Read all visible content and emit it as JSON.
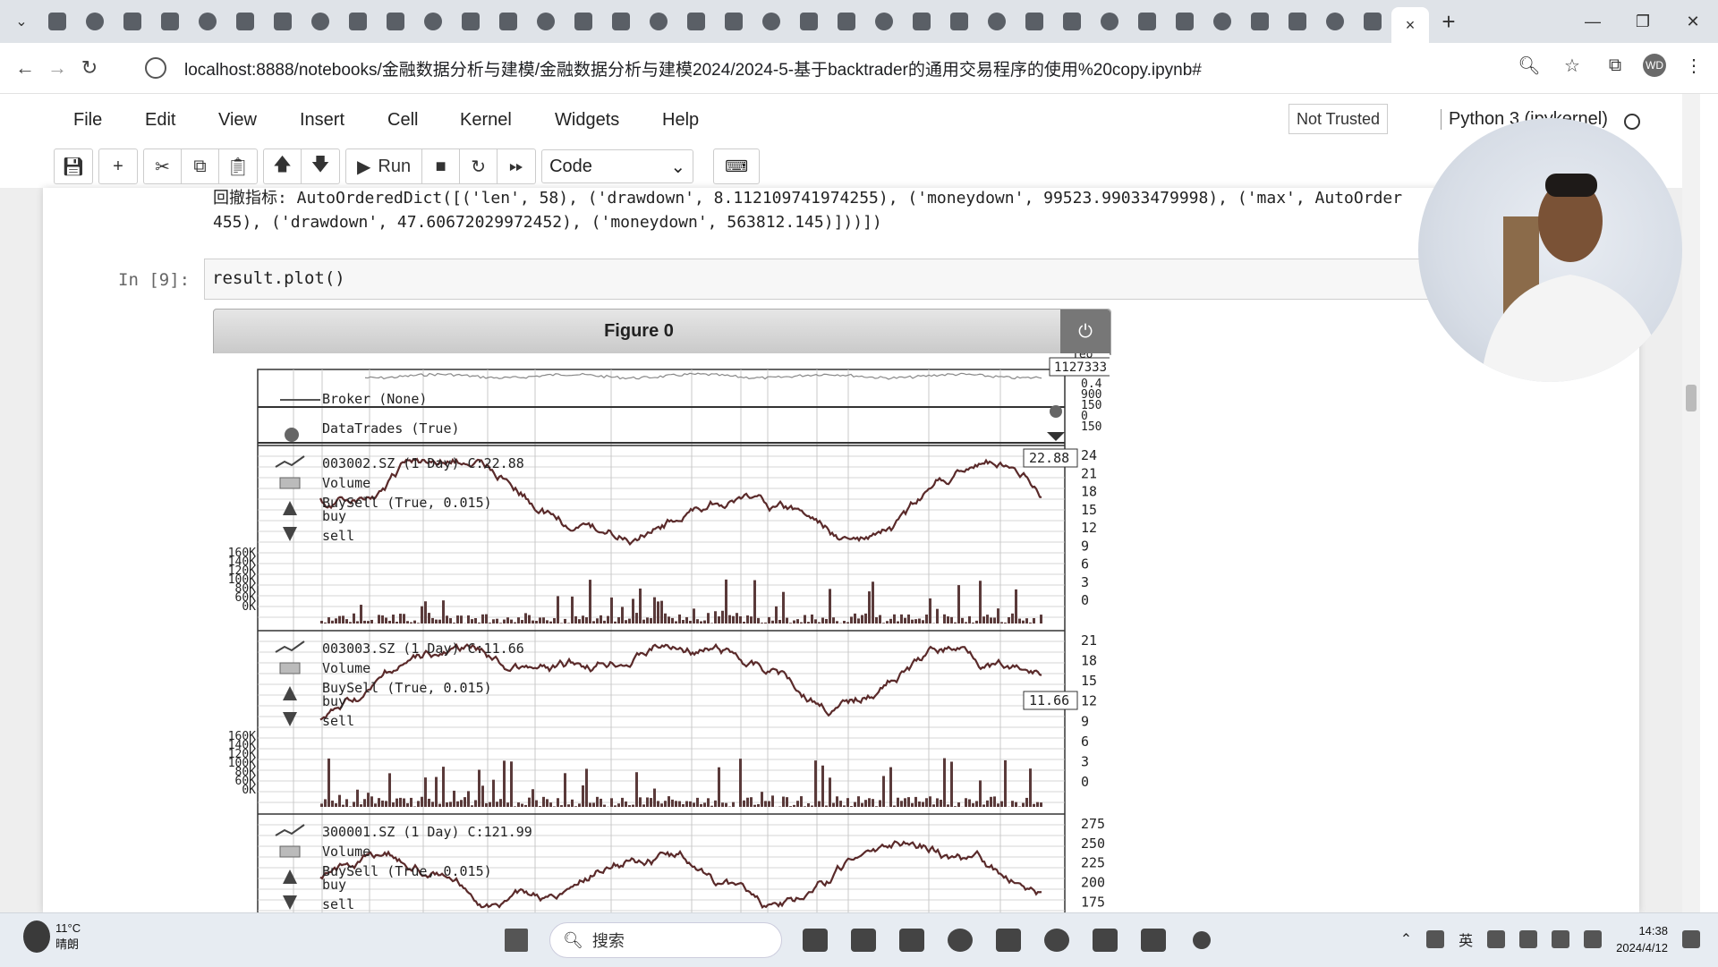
{
  "browser": {
    "tab_strip": {
      "active_close": "×",
      "new_tab": "+",
      "tab_icons": [
        "bilibili",
        "chat",
        "circle",
        "github",
        "notion",
        "media",
        "media2",
        "fiftyone",
        "github",
        "message",
        "cloud",
        "cloud2",
        "figure",
        "book",
        "avatar",
        "globe",
        "kit",
        "flower",
        "github",
        "github",
        "disc",
        "zhihu",
        "zhihu",
        "github",
        "c-app",
        "aiyou",
        "globe",
        "m-app",
        "k-app",
        "simplified",
        "loop",
        "book",
        "book",
        "book",
        "paw",
        "zhihu"
      ],
      "window_controls": {
        "minimize": "—",
        "restore": "❐",
        "close": "✕"
      }
    },
    "url": "localhost:8888/notebooks/金融数据分析与建模/金融数据分析与建模2024/2024-5-基于backtrader的通用交易程序的使用%20copy.ipynb#",
    "profile_badge": "WD"
  },
  "jupyter": {
    "menu": [
      "File",
      "Edit",
      "View",
      "Insert",
      "Cell",
      "Kernel",
      "Widgets",
      "Help"
    ],
    "trust_status": "Not Trusted",
    "kernel_name": "Python 3 (ipykernel)",
    "toolbar": {
      "run_label": "Run",
      "cell_type": "Code"
    }
  },
  "notebook": {
    "output_line1": "回撤指标: AutoOrderedDict([('len', 58), ('drawdown', 8.112109741974255), ('moneydown', 99523.99033479998), ('max', AutoOrder",
    "output_line2": "455), ('drawdown', 47.60672029972452), ('moneydown', 563812.145)]))])",
    "prompt": "In  [9]:",
    "code": "result.plot()"
  },
  "figure": {
    "title": "Figure 0",
    "broker_panel": {
      "legend": "Broker (None)",
      "value_label": "1127333.0",
      "axis_ticks": [
        "0.4",
        "900",
        "150",
        "0",
        "150"
      ],
      "top_fragment": "Teo"
    },
    "trades_panel": {
      "legend": "DataTrades (True)"
    },
    "stocks": [
      {
        "legend": "003002.SZ (1 Day) C:22.88",
        "last_label": "22.88",
        "price_ticks": [
          "24",
          "21",
          "18",
          "15",
          "12",
          "9",
          "6",
          "3",
          "0"
        ],
        "sub_legends": [
          "Volume",
          "BuySell (True, 0.015)",
          "buy",
          "sell"
        ],
        "volume_ticks": [
          "160K",
          "140K",
          "120K",
          "100K",
          "80K",
          "60K",
          "0K"
        ]
      },
      {
        "legend": "003003.SZ (1 Day) C:11.66",
        "last_label": "11.66",
        "price_ticks": [
          "21",
          "18",
          "15",
          "12",
          "9",
          "6",
          "3",
          "0"
        ],
        "sub_legends": [
          "Volume",
          "BuySell (True, 0.015)",
          "buy",
          "sell"
        ],
        "volume_ticks": [
          "160K",
          "140K",
          "120K",
          "100K",
          "80K",
          "60K",
          "0K"
        ]
      },
      {
        "legend": "300001.SZ (1 Day) C:121.99",
        "last_label": "",
        "price_ticks": [
          "275",
          "250",
          "225",
          "200",
          "175"
        ],
        "sub_legends": [
          "Volume",
          "BuySell (True, 0.015)",
          "buy",
          "sell"
        ],
        "volume_ticks": []
      }
    ]
  },
  "taskbar": {
    "temperature": "11°C",
    "weather": "晴朗",
    "search_placeholder": "搜索",
    "time": "14:38",
    "date": "2024/4/12",
    "ime": "英"
  },
  "colors": {
    "line": "#5a2a2a",
    "volume": "#5a3a3a",
    "grid": "#c8c8c8"
  }
}
